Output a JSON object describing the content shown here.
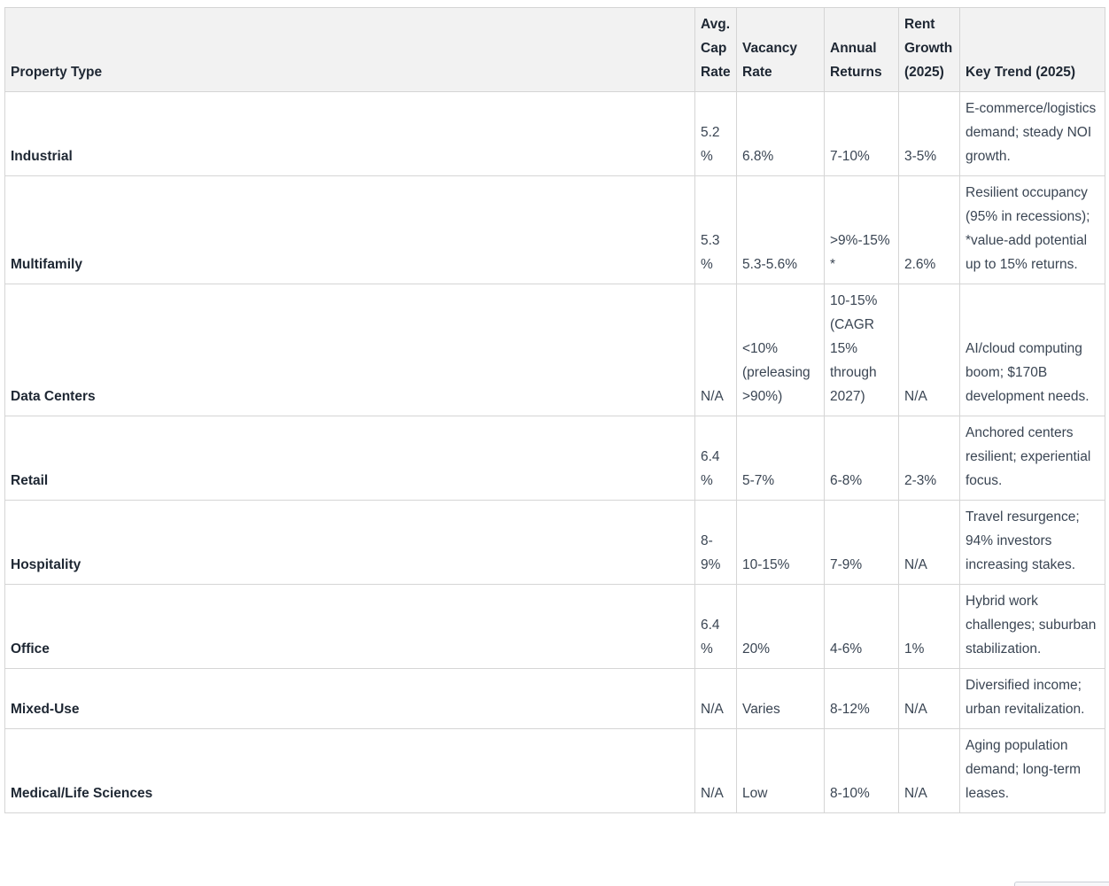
{
  "table": {
    "headers": [
      "Property Type",
      "Avg. Cap Rate",
      "Vacancy Rate",
      "Annual Returns",
      "Rent Growth (2025)",
      "Key Trend (2025)"
    ],
    "rows": [
      [
        "Industrial",
        "5.2%",
        "6.8%",
        "7-10%",
        "3-5%",
        "E-commerce/logistics demand; steady NOI growth."
      ],
      [
        "Multifamily",
        "5.3%",
        "5.3-5.6%",
        ">9%-15%*",
        "2.6%",
        "Resilient occupancy (95% in recessions); *value-add potential up to 15% returns."
      ],
      [
        "Data Centers",
        "N/A",
        "<10% (preleasing >90%)",
        "10-15% (CAGR 15% through 2027)",
        "N/A",
        "AI/cloud computing boom; $170B development needs."
      ],
      [
        "Retail",
        "6.4%",
        "5-7%",
        "6-8%",
        "2-3%",
        "Anchored centers resilient; experiential focus."
      ],
      [
        "Hospitality",
        "8-9%",
        "10-15%",
        "7-9%",
        "N/A",
        "Travel resurgence; 94% investors increasing stakes."
      ],
      [
        "Office",
        "6.4%",
        "20%",
        "4-6%",
        "1%",
        "Hybrid work challenges; suburban stabilization."
      ],
      [
        "Mixed-Use",
        "N/A",
        "Varies",
        "8-12%",
        "N/A",
        "Diversified income; urban revitalization."
      ],
      [
        "Medical/Life Sciences",
        "N/A",
        "Low",
        "8-10%",
        "N/A",
        "Aging population demand; long-term leases."
      ]
    ]
  }
}
